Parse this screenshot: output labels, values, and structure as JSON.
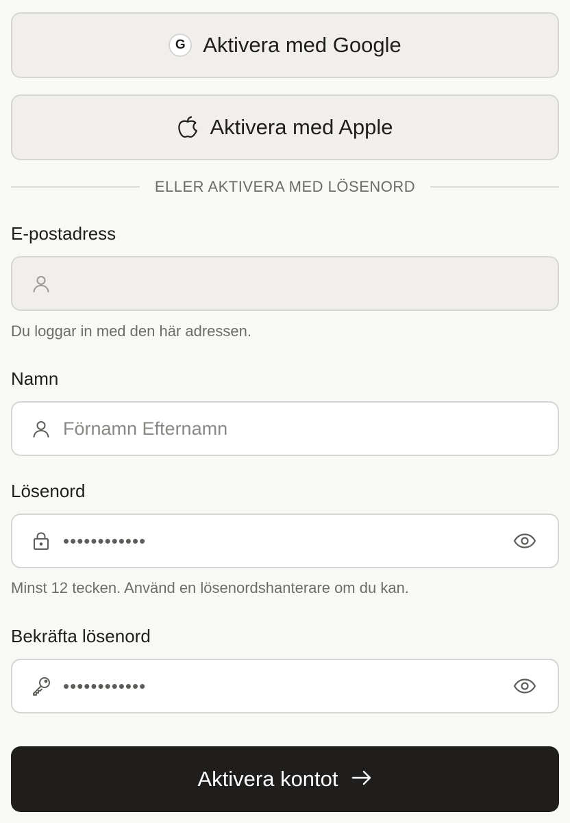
{
  "oauth": {
    "google_label": "Aktivera med Google",
    "google_glyph": "G",
    "apple_label": "Aktivera med Apple"
  },
  "divider": {
    "text": "ELLER AKTIVERA MED LÖSENORD"
  },
  "form": {
    "email": {
      "label": "E-postadress",
      "value": "",
      "help": "Du loggar in med den här adressen.",
      "icon": "user-icon",
      "disabled": true
    },
    "name": {
      "label": "Namn",
      "placeholder": "Förnamn Efternamn",
      "icon": "user-icon"
    },
    "password": {
      "label": "Lösenord",
      "masked_value": "••••••••••••",
      "help": "Minst 12 tecken. Använd en lösenordshanterare om du kan.",
      "icon": "lock-icon"
    },
    "confirm_password": {
      "label": "Bekräfta lösenord",
      "masked_value": "••••••••••••",
      "icon": "key-icon"
    }
  },
  "submit": {
    "label": "Aktivera kontot",
    "icon": "arrow-right-icon"
  },
  "colors": {
    "background": "#f8f8f6",
    "primary_button": "#1f1e1c",
    "secondary_button": "#f0efed",
    "border": "#d6d5d1",
    "muted_text": "#6e6c68"
  }
}
